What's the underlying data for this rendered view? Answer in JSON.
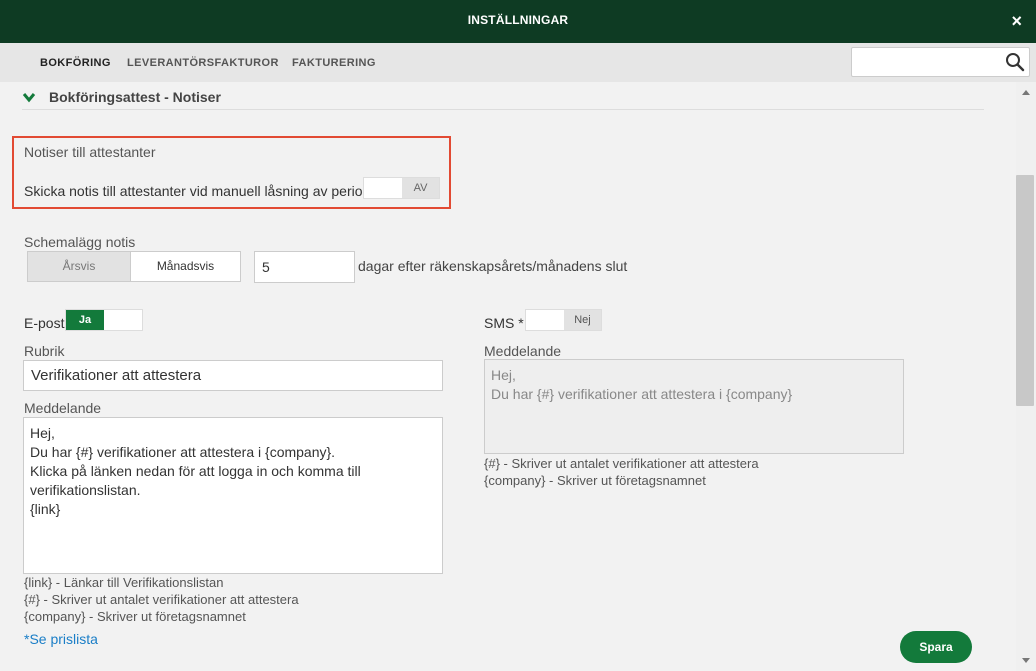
{
  "window": {
    "title": "INSTÄLLNINGAR",
    "close": "×"
  },
  "tabs": [
    {
      "label": "BOKFÖRING"
    },
    {
      "label": "LEVERANTÖRSFAKTUROR"
    },
    {
      "label": "FAKTURERING"
    }
  ],
  "search": {
    "value": "",
    "placeholder": ""
  },
  "section": {
    "title": "Bokföringsattest - Notiser"
  },
  "notify": {
    "heading": "Notiser till attestanter",
    "manual_lock_label": "Skicka notis till attestanter vid manuell låsning av period",
    "manual_lock_state": "AV"
  },
  "schedule": {
    "label": "Schemalägg notis",
    "options": [
      {
        "label": "Årsvis"
      },
      {
        "label": "Månadsvis"
      }
    ],
    "selected": "Månadsvis",
    "days_value": "5",
    "days_suffix": "dagar efter räkenskapsårets/månadens slut"
  },
  "email": {
    "label": "E-post",
    "toggle_state": "Ja",
    "subject_label": "Rubrik",
    "subject_value": "Verifikationer att attestera",
    "message_label": "Meddelande",
    "message_value": "Hej,\nDu har {#} verifikationer att attestera i {company}.\nKlicka på länken nedan för att logga in och komma till verifikationslistan.\n{link}",
    "help": [
      "{link} - Länkar till Verifikationslistan",
      "{#} - Skriver ut antalet verifikationer att attestera",
      "{company} - Skriver ut företagsnamnet"
    ]
  },
  "sms": {
    "label": "SMS *",
    "toggle_state": "Nej",
    "message_label": "Meddelande",
    "message_value": "Hej,\nDu har {#} verifikationer att attestera i {company}",
    "help": [
      "{#} - Skriver ut antalet verifikationer att attestera",
      "{company} - Skriver ut företagsnamnet"
    ]
  },
  "price_link": "*Se prislista",
  "save_label": "Spara",
  "colors": {
    "header_bg": "#0e3b23",
    "accent_green": "#137a3b",
    "highlight_red": "#e24a33",
    "link_blue": "#1a7ec7"
  },
  "icons": {
    "close": "close-icon",
    "search": "search-icon",
    "chevron": "chevron-down-icon"
  }
}
